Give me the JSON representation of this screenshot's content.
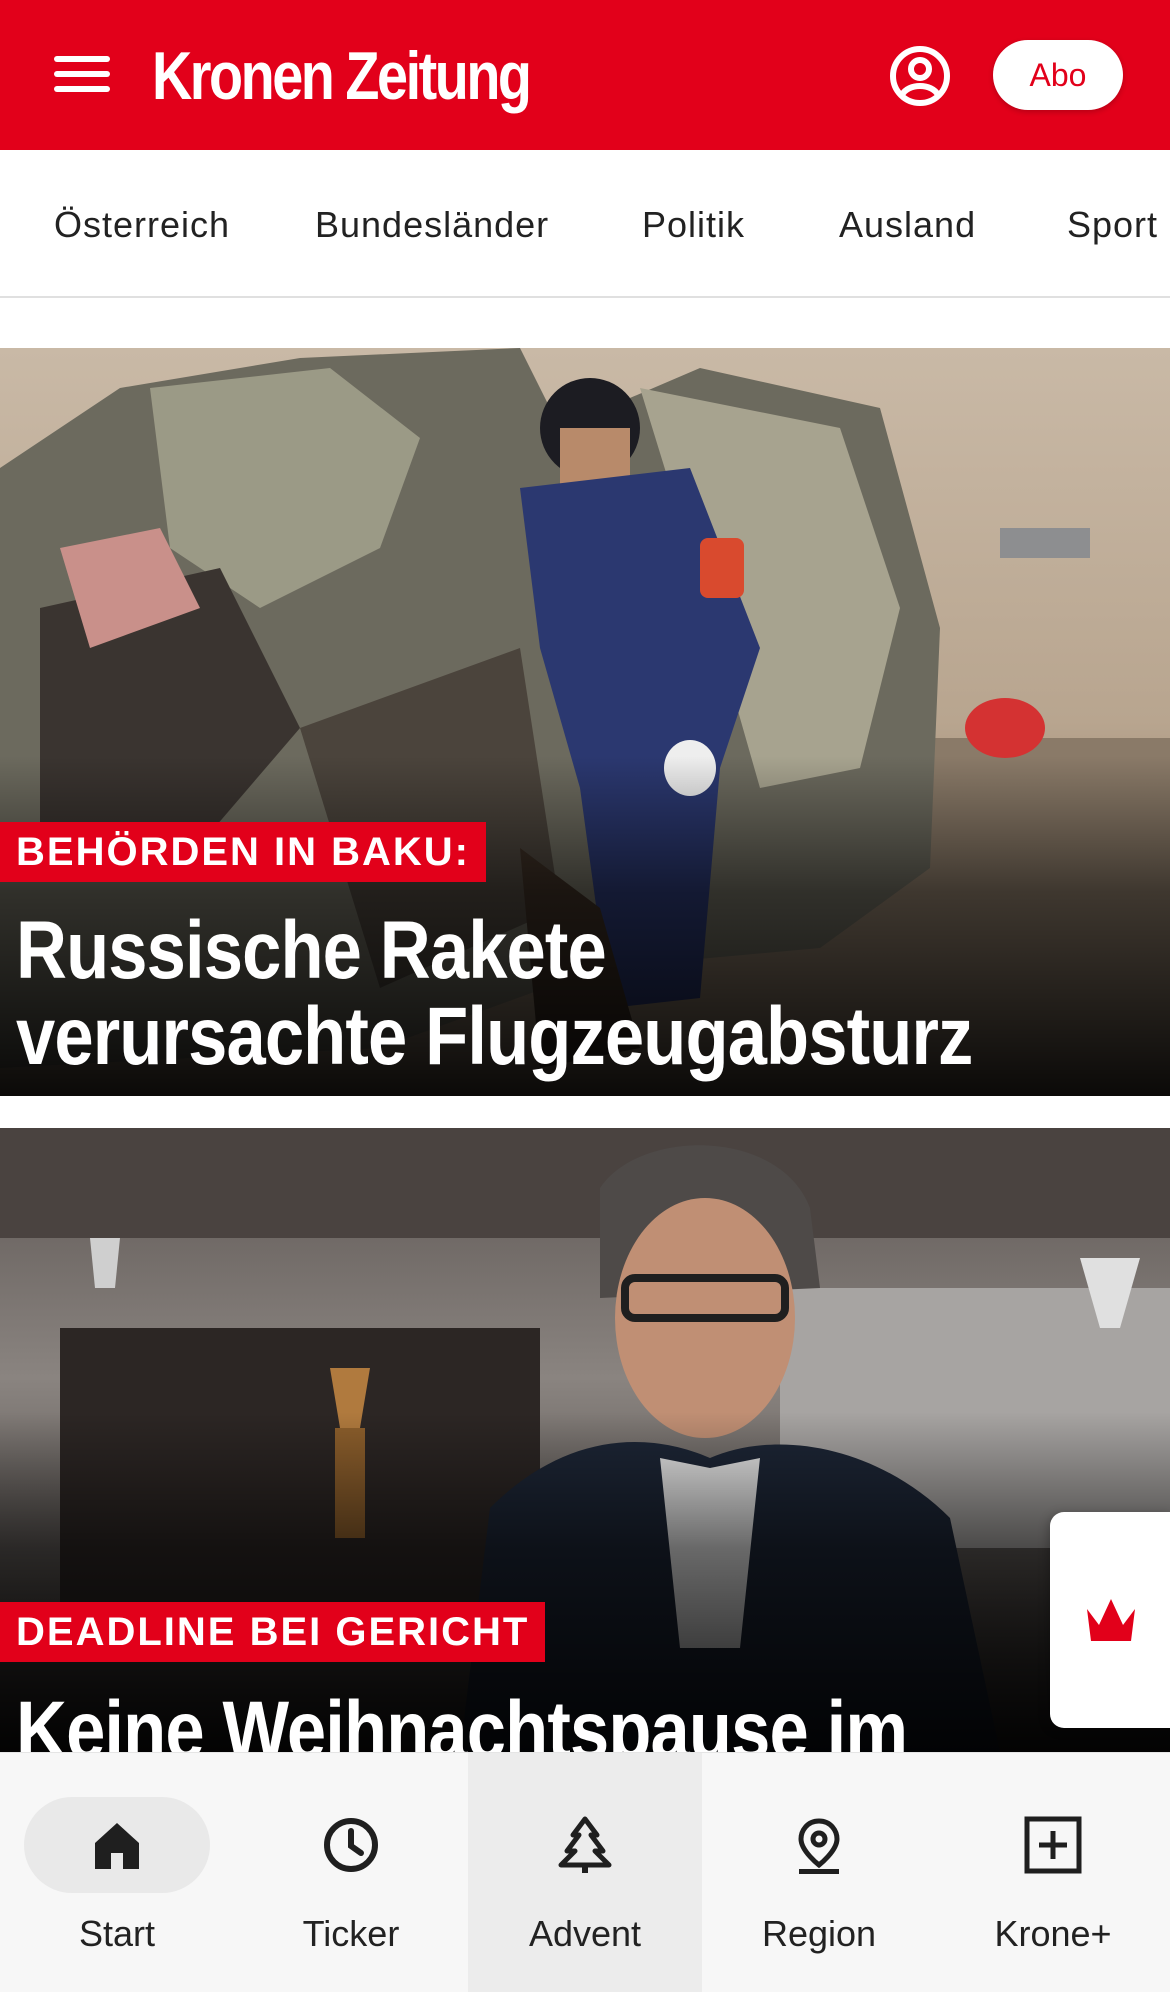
{
  "header": {
    "logo": "Kronen Zeitung",
    "abo_label": "Abo"
  },
  "categories": [
    "Österreich",
    "Bundesländer",
    "Politik",
    "Ausland",
    "Sport"
  ],
  "articles": [
    {
      "kicker": "BEHÖRDEN IN BAKU:",
      "headline_line1": "Russische Rakete",
      "headline_line2": "verursachte Flugzeugabsturz"
    },
    {
      "kicker": "DEADLINE BEI GERICHT",
      "headline_line1": "Keine Weihnachtspause im"
    }
  ],
  "bottom_nav": [
    {
      "label": "Start",
      "icon": "home-icon"
    },
    {
      "label": "Ticker",
      "icon": "clock-icon"
    },
    {
      "label": "Advent",
      "icon": "tree-icon"
    },
    {
      "label": "Region",
      "icon": "location-pin-icon"
    },
    {
      "label": "Krone+",
      "icon": "plus-box-icon"
    }
  ],
  "colors": {
    "brand_red": "#e2001a",
    "nav_background": "#f7f7f7"
  }
}
